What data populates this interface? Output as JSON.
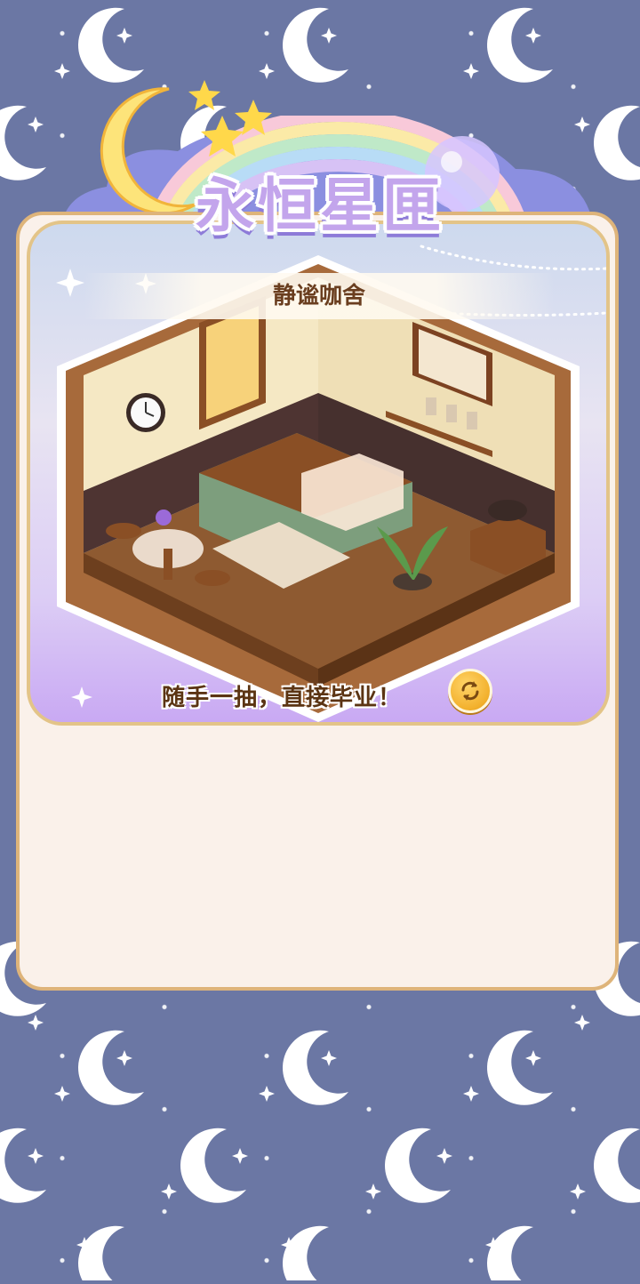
{
  "header": {
    "title": "永恒星匣"
  },
  "card": {
    "room_name": "静谧咖舍",
    "tagline": "随手一抽，直接毕业！"
  },
  "icons": {
    "refresh": "refresh-icon",
    "moon": "crescent-moon-icon",
    "star": "star-icon"
  },
  "colors": {
    "background": "#6b77a4",
    "panel": "#faf1ea",
    "panel_border": "#deb47a",
    "title": "#c3a5ec",
    "accent_gold": "#f2b02c"
  }
}
